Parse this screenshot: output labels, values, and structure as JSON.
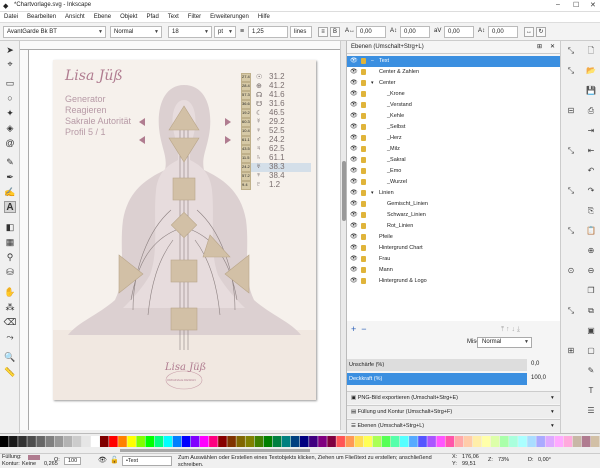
{
  "window": {
    "title": "*Chartvorlage.svg - Inkscape",
    "minimize": "–",
    "maximize": "☐",
    "close": "✕"
  },
  "menu": [
    "Datei",
    "Bearbeiten",
    "Ansicht",
    "Ebene",
    "Objekt",
    "Pfad",
    "Text",
    "Filter",
    "Erweiterungen",
    "Hilfe"
  ],
  "toolctrl": {
    "font_family": "AvantGarde Bk BT",
    "font_style": "Normal",
    "font_size": "18",
    "unit": "pt",
    "line_spacing": "1,25",
    "spacing_unit": "lines",
    "kern1": "0,00",
    "kern2": "0,00",
    "kern3": "0,00",
    "kern4": "0,00"
  },
  "layers_panel": {
    "title": "Ebenen (Umschalt+Strg+L)",
    "layers": [
      {
        "name": "Text",
        "expander": "–",
        "selected": true
      },
      {
        "name": "Center & Zahlen",
        "expander": "",
        "selected": false
      },
      {
        "name": "Center",
        "expander": "▾",
        "selected": false
      },
      {
        "name": "_Krone",
        "expander": "",
        "selected": false
      },
      {
        "name": "_Verstand",
        "expander": "",
        "selected": false
      },
      {
        "name": "_Kehle",
        "expander": "",
        "selected": false
      },
      {
        "name": "_Selbst",
        "expander": "",
        "selected": false
      },
      {
        "name": "_Herz",
        "expander": "",
        "selected": false
      },
      {
        "name": "_Milz",
        "expander": "",
        "selected": false
      },
      {
        "name": "_Sakral",
        "expander": "",
        "selected": false
      },
      {
        "name": "_Emo",
        "expander": "",
        "selected": false
      },
      {
        "name": "_Wurzel",
        "expander": "",
        "selected": false
      },
      {
        "name": "Linien",
        "expander": "▾",
        "selected": false
      },
      {
        "name": "Gemischt_Linien",
        "expander": "",
        "selected": false
      },
      {
        "name": "Schwarz_Linien",
        "expander": "",
        "selected": false
      },
      {
        "name": "Rot_Linien",
        "expander": "",
        "selected": false
      },
      {
        "name": "Pfeile",
        "expander": "",
        "selected": false
      },
      {
        "name": "Hintergrund Chart",
        "expander": "",
        "selected": false
      },
      {
        "name": "Frau",
        "expander": "",
        "selected": false
      },
      {
        "name": "Mann",
        "expander": "",
        "selected": false
      },
      {
        "name": "Hintergrund & Logo",
        "expander": "",
        "selected": false
      }
    ],
    "blend_label": "Mischmodus:",
    "blend_value": "Normal",
    "blur_label": "Unschärfe (%)",
    "blur_value": "0,0",
    "opacity_label": "Deckkraft (%)",
    "opacity_value": "100,0",
    "collapsed": [
      "PNG-Bild exportieren (Umschalt+Strg+E)",
      "Füllung und Kontur (Umschalt+Strg+F)",
      "Ebenen (Umschalt+Strg+L)"
    ]
  },
  "document": {
    "name": "Lisa Jüß",
    "lines": [
      "Generator",
      "Reagieren",
      "Sakrale Autorität",
      "Profil 5 / 1"
    ],
    "logo_sub": "ORIGINALE DESIGN",
    "numbers": [
      {
        "tag": "27.4",
        "glyph": "☉",
        "value": "31.2"
      },
      {
        "tag": "28.4",
        "glyph": "⊕",
        "value": "41.2"
      },
      {
        "tag": "57.3",
        "glyph": "☊",
        "value": "41.6"
      },
      {
        "tag": "36.6",
        "glyph": "☋",
        "value": "31.6"
      },
      {
        "tag": "19.2",
        "glyph": "☾",
        "value": "46.5"
      },
      {
        "tag": "60.3",
        "glyph": "☿",
        "value": "29.2"
      },
      {
        "tag": "10.4",
        "glyph": "♀",
        "value": "52.5"
      },
      {
        "tag": "61.1",
        "glyph": "♂",
        "value": "24.2"
      },
      {
        "tag": "43.5",
        "glyph": "♃",
        "value": "62.5"
      },
      {
        "tag": "11.5",
        "glyph": "♄",
        "value": "61.1"
      },
      {
        "tag": "24.2",
        "glyph": "♅",
        "value": "38.3"
      },
      {
        "tag": "57.2",
        "glyph": "♆",
        "value": "38.4"
      },
      {
        "tag": "9.4",
        "glyph": "♇",
        "value": "1.2"
      }
    ]
  },
  "status": {
    "fill_label": "Füllung:",
    "stroke_label": "Kontur:",
    "stroke_value": "Keine",
    "width_value": "0,265",
    "opacity_label": "O:",
    "opacity_value": "100",
    "layer_value": "•Text",
    "message": "Zum Auswählen oder Erstellen eines Textobjekts klicken, Ziehen um Fließtext zu erstellen; anschließend schreiben.",
    "x_label": "X:",
    "x_value": "176,06",
    "y_label": "Y:",
    "y_value": "99,51",
    "z_label": "Z:",
    "zoom": "73%",
    "r_label": "D:",
    "rotation": "0,00°"
  },
  "colors": {
    "selection": "#3b8fe0",
    "center_fill": "#d2c0a6",
    "text_mauve": "#b07c90"
  }
}
